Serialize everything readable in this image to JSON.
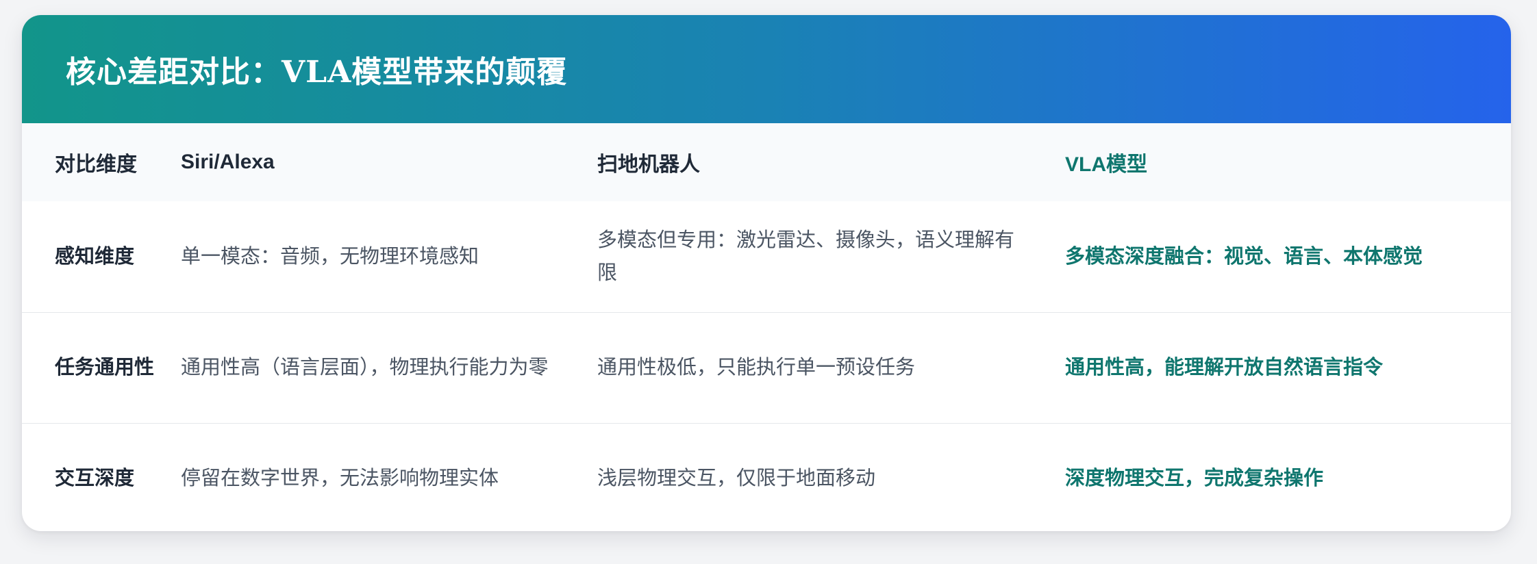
{
  "title": "核心差距对比：VLA模型带来的颠覆",
  "table": {
    "headers": [
      "对比维度",
      "Siri/Alexa",
      "扫地机器人",
      "VLA模型"
    ],
    "rows": [
      {
        "dimension": "感知维度",
        "siri": "单一模态：音频，无物理环境感知",
        "robot": "多模态但专用：激光雷达、摄像头，语义理解有限",
        "vla": "多模态深度融合：视觉、语言、本体感觉"
      },
      {
        "dimension": "任务通用性",
        "siri": "通用性高（语言层面），物理执行能力为零",
        "robot": "通用性极低，只能执行单一预设任务",
        "vla": "通用性高，能理解开放自然语言指令"
      },
      {
        "dimension": "交互深度",
        "siri": "停留在数字世界，无法影响物理实体",
        "robot": "浅层物理交互，仅限于地面移动",
        "vla": "深度物理交互，完成复杂操作"
      }
    ]
  },
  "colors": {
    "header_gradient_start": "#12958a",
    "header_gradient_end": "#2563eb",
    "vla_accent": "#0f766e"
  }
}
